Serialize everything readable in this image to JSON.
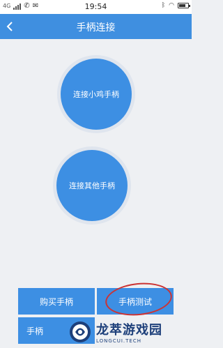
{
  "status_bar": {
    "network": "4G",
    "time": "19:54"
  },
  "header": {
    "title": "手柄连接",
    "back_icon": "chevron-left-icon"
  },
  "main": {
    "connect_chick_label": "连接小鸡手柄",
    "connect_other_label": "连接其他手柄"
  },
  "bottom": {
    "buy_label": "购买手柄",
    "test_label": "手柄测试",
    "third_label": "手柄"
  },
  "watermark": {
    "title": "龙萃游戏园",
    "subtitle": "LONGCUI.TECH"
  },
  "colors": {
    "primary": "#3f8fe0",
    "background": "#eef0f3",
    "highlight_ellipse": "#cc3333"
  }
}
